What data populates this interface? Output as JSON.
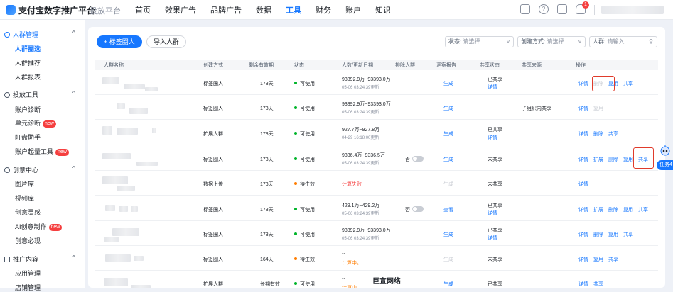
{
  "app": {
    "brand": "支付宝数字推广平台",
    "brand_sub": "投放平台"
  },
  "nav": [
    "首页",
    "效果广告",
    "品牌广告",
    "数据",
    "工具",
    "财务",
    "账户",
    "知识"
  ],
  "nav_active": 4,
  "notification_count": "1",
  "sidebar": {
    "groups": [
      {
        "label": "人群管理",
        "items": [
          "人群圈选",
          "人群推荐",
          "人群报表"
        ]
      },
      {
        "label": "投放工具",
        "items": [
          "账户诊断",
          "单元诊断",
          "盯盘助手",
          "账户起量工具"
        ]
      },
      {
        "label": "创意中心",
        "items": [
          "图片库",
          "视频库",
          "创意灵感",
          "AI创意制作",
          "创意必现"
        ]
      },
      {
        "label": "推广内容",
        "items": [
          "应用管理",
          "店铺管理"
        ]
      }
    ],
    "new_tag": "new"
  },
  "toolbar": {
    "add_label": "+ 标签圈人",
    "import_label": "导入人群"
  },
  "filters": {
    "status": {
      "label": "状态:",
      "placeholder": "请选择"
    },
    "create": {
      "label": "创建方式:",
      "placeholder": "请选择"
    },
    "crowd": {
      "label": "人群:",
      "placeholder": "请输入"
    }
  },
  "table": {
    "headers": [
      "人群名称",
      "创建方式",
      "剩余有效期",
      "状态",
      "人数/更新日期",
      "排除人群",
      "洞察报告",
      "共享状态",
      "共享来源",
      "操作"
    ],
    "rows": [
      {
        "method": "标签圈人",
        "valid": "173天",
        "status": "可使用",
        "status_color": "green",
        "count": "93392.9万~93393.0万",
        "date": "05-06 03:24:39更新",
        "exclude": "",
        "report": "生成",
        "share": "已共享",
        "share_detail": "详情",
        "source": "",
        "ops": [
          "详情",
          "删除",
          "复用",
          "共享"
        ]
      },
      {
        "method": "标签圈人",
        "valid": "173天",
        "status": "可使用",
        "status_color": "green",
        "count": "93392.9万~93393.0万",
        "date": "05-06 03:24:39更新",
        "exclude": "",
        "report": "生成",
        "share": "",
        "share_detail": "",
        "source": "子组织内共享",
        "ops": [
          "详情",
          "复用"
        ]
      },
      {
        "method": "扩展人群",
        "valid": "173天",
        "status": "可使用",
        "status_color": "green",
        "count": "927.7万~927.8万",
        "date": "04-29 16:18:00更新",
        "exclude": "",
        "report": "生成",
        "share": "已共享",
        "share_detail": "详情",
        "source": "",
        "ops": [
          "详情",
          "删除",
          "共享"
        ]
      },
      {
        "method": "标签圈人",
        "valid": "173天",
        "status": "可使用",
        "status_color": "green",
        "count": "9336.4万~9336.5万",
        "date": "05-06 03:24:39更新",
        "exclude": "否",
        "report": "生成",
        "share": "未共享",
        "share_detail": "",
        "source": "",
        "ops": [
          "详情",
          "扩展",
          "删除",
          "复用",
          "共享"
        ]
      },
      {
        "method": "数据上传",
        "valid": "173天",
        "status": "待生效",
        "status_color": "orange",
        "count": "计算失败",
        "date": "",
        "exclude": "",
        "report": "生成",
        "share": "未共享",
        "share_detail": "",
        "source": "",
        "ops": [
          "详情"
        ]
      },
      {
        "method": "标签圈人",
        "valid": "173天",
        "status": "可使用",
        "status_color": "green",
        "count": "429.1万~429.2万",
        "date": "05-06 03:24:39更新",
        "exclude": "否",
        "report": "查看",
        "share": "已共享",
        "share_detail": "详情",
        "source": "",
        "ops": [
          "详情",
          "扩展",
          "删除",
          "复用",
          "共享"
        ]
      },
      {
        "method": "标签圈人",
        "valid": "173天",
        "status": "可使用",
        "status_color": "green",
        "count": "93392.9万~93393.0万",
        "date": "05-06 03:24:39更新",
        "exclude": "",
        "report": "生成",
        "share": "已共享",
        "share_detail": "详情",
        "source": "",
        "ops": [
          "详情",
          "删除",
          "复用",
          "共享"
        ]
      },
      {
        "method": "标签圈人",
        "valid": "164天",
        "status": "待生效",
        "status_color": "orange",
        "count": "--",
        "date": "计算中。",
        "exclude": "",
        "report": "生成",
        "share": "未共享",
        "share_detail": "",
        "source": "",
        "ops": [
          "详情",
          "复用",
          "共享"
        ]
      },
      {
        "method": "扩展人群",
        "valid": "长期有效",
        "status": "可使用",
        "status_color": "green",
        "count": "--",
        "date": "计算中。",
        "exclude": "",
        "report": "生成",
        "share": "已共享",
        "share_detail": "",
        "source": "",
        "ops": [
          "详情",
          "共享"
        ]
      }
    ]
  },
  "float": {
    "task": "任务4"
  },
  "watermark": "巨宣网络"
}
